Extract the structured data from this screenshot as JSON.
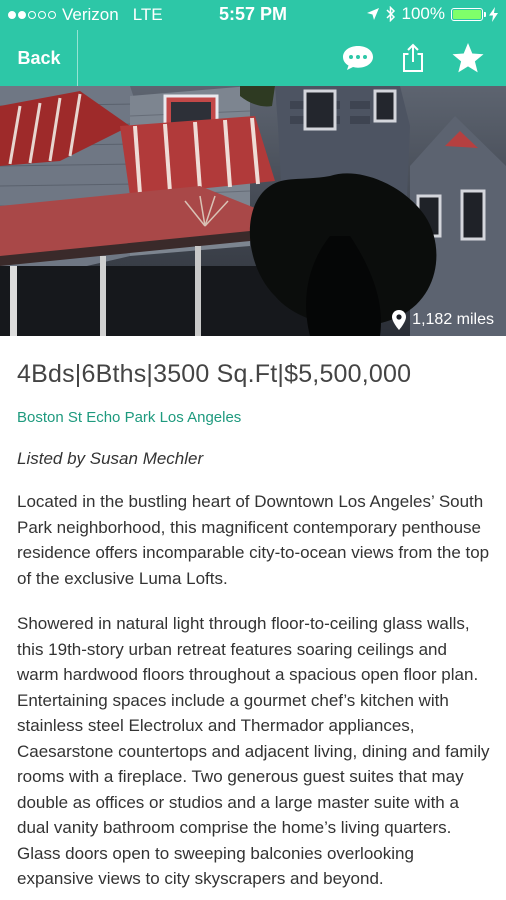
{
  "status_bar": {
    "carrier": "Verizon",
    "network": "LTE",
    "time": "5:57 PM",
    "battery": "100%",
    "signal_bars_filled": 2,
    "signal_bars_total": 5
  },
  "nav": {
    "back_label": "Back",
    "icons": [
      "chat-bubble-icon",
      "share-icon",
      "star-icon"
    ]
  },
  "hero": {
    "distance": "1,182 miles"
  },
  "listing": {
    "headline": "4Bds|6Bths|3500 Sq.Ft|$5,500,000",
    "address": "Boston St Echo Park Los Angeles",
    "listed_by": "Listed by Susan Mechler",
    "description_1": "Located in the bustling heart of Downtown Los Angeles’ South Park neighborhood, this magnificent contemporary penthouse residence offers incomparable city-to-ocean views from the top of the exclusive Luma Lofts.",
    "description_2": "Showered in natural light through floor-to-ceiling glass walls, this 19th-story urban retreat features soaring ceilings and warm hardwood floors throughout a spacious open floor plan. Entertaining spaces include a gourmet chef’s kitchen with stainless steel Electrolux and Thermador appliances, Caesarstone countertops and adjacent living, dining and family rooms with a fireplace. Two generous guest suites that may double as offices or studios and a large master suite with a dual vanity bathroom comprise the home’s living quarters. Glass doors open to sweeping balconies overlooking expansive views to city skyscrapers and beyond."
  },
  "colors": {
    "accent": "#2dc7a7",
    "link": "#1e9a7e",
    "text": "#333333"
  }
}
